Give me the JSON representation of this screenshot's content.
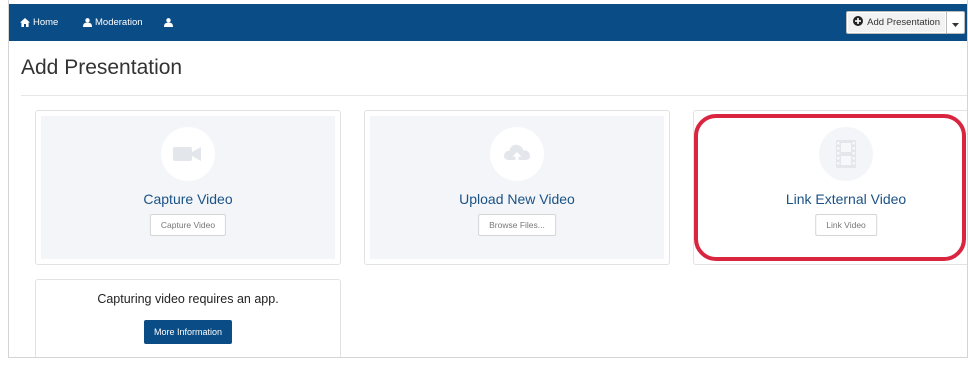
{
  "nav": {
    "home_label": "Home",
    "moderation_label": "Moderation",
    "add_presentation_label": "Add Presentation"
  },
  "page": {
    "title": "Add Presentation"
  },
  "cards": [
    {
      "title": "Capture Video",
      "button": "Capture Video",
      "icon": "video-camera-icon"
    },
    {
      "title": "Upload New Video",
      "button": "Browse Files...",
      "icon": "cloud-upload-icon"
    },
    {
      "title": "Link External Video",
      "button": "Link Video",
      "icon": "film-icon"
    }
  ],
  "info": {
    "text": "Capturing video requires an app.",
    "button": "More Information"
  },
  "colors": {
    "navbar": "#0a4c85",
    "card_background": "#f3f5f8",
    "title_blue": "#1b5286",
    "highlight": "#d9253f"
  }
}
